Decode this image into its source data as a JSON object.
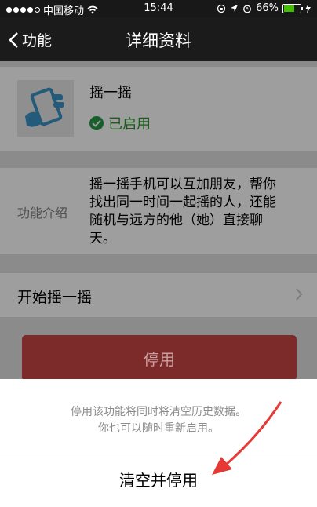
{
  "status_bar": {
    "carrier": "中国移动",
    "time": "15:44",
    "battery_text": "66%",
    "battery_level": 0.66
  },
  "nav": {
    "back_label": "功能",
    "title": "详细资料"
  },
  "feature": {
    "name": "摇一摇",
    "status": "已启用"
  },
  "intro": {
    "label": "功能介绍",
    "lines": [
      "摇一摇手机可以互加朋友，帮你",
      "找出同一时间一起摇的人，还能",
      "随机与远方的他（她）直接聊",
      "天。"
    ]
  },
  "start_row": {
    "label": "开始摇一摇"
  },
  "disable_button": {
    "label": "停用"
  },
  "action_sheet": {
    "message_lines": [
      "停用该功能将同时将清空历史数据。",
      "你也可以随时重新启用。"
    ],
    "action_label": "清空并停用"
  },
  "colors": {
    "accent_green": "#43c000",
    "disable_red": "#d94a4a",
    "annotation_arrow": "#e53935"
  }
}
